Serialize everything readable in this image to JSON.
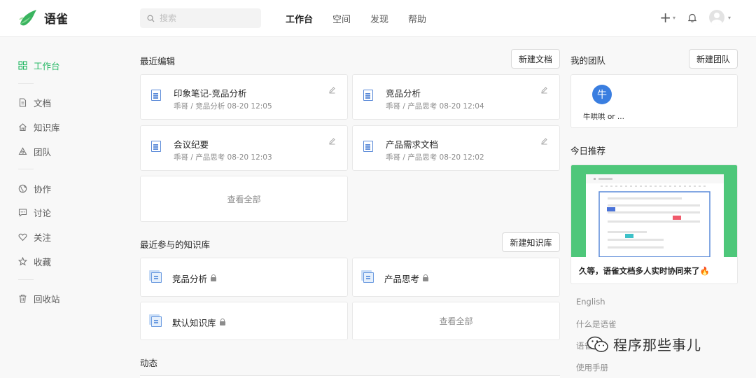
{
  "header": {
    "logo_text": "语雀",
    "search_placeholder": "搜索",
    "nav": [
      "工作台",
      "空间",
      "发现",
      "帮助"
    ],
    "plus": "+",
    "caret": "▾"
  },
  "sidebar": {
    "items": [
      "工作台",
      "文档",
      "知识库",
      "团队",
      "协作",
      "讨论",
      "关注",
      "收藏",
      "回收站"
    ]
  },
  "recent": {
    "title": "最近编辑",
    "new_button": "新建文档",
    "docs": [
      {
        "title": "印象笔记-竞品分析",
        "meta": "乖哥 / 竞品分析   08-20 12:05"
      },
      {
        "title": "竞品分析",
        "meta": "乖哥 / 产品思考   08-20 12:04"
      },
      {
        "title": "会议纪要",
        "meta": "乖哥 / 产品思考   08-20 12:03"
      },
      {
        "title": "产品需求文档",
        "meta": "乖哥 / 产品思考   08-20 12:02"
      }
    ],
    "see_all": "查看全部"
  },
  "books": {
    "title": "最近参与的知识库",
    "new_button": "新建知识库",
    "items": [
      "竞品分析",
      "产品思考",
      "默认知识库"
    ],
    "see_all": "查看全部"
  },
  "activity": {
    "title": "动态"
  },
  "team": {
    "title": "我的团队",
    "new_button": "新建团队",
    "avatar_char": "牛",
    "name": "牛哄哄 or ..."
  },
  "recommend": {
    "title": "今日推荐",
    "caption": "久等，语雀文档多人实时协同来了🔥"
  },
  "footer_links": [
    "English",
    "什么是语雀",
    "语雀",
    "使用手册"
  ],
  "watermark": "程序那些事儿",
  "colors": {
    "accent": "#25b864",
    "doc_icon": "#5a8ad8",
    "team_avatar": "#3a7ee0",
    "recommend_bg": "#4ec77a"
  }
}
